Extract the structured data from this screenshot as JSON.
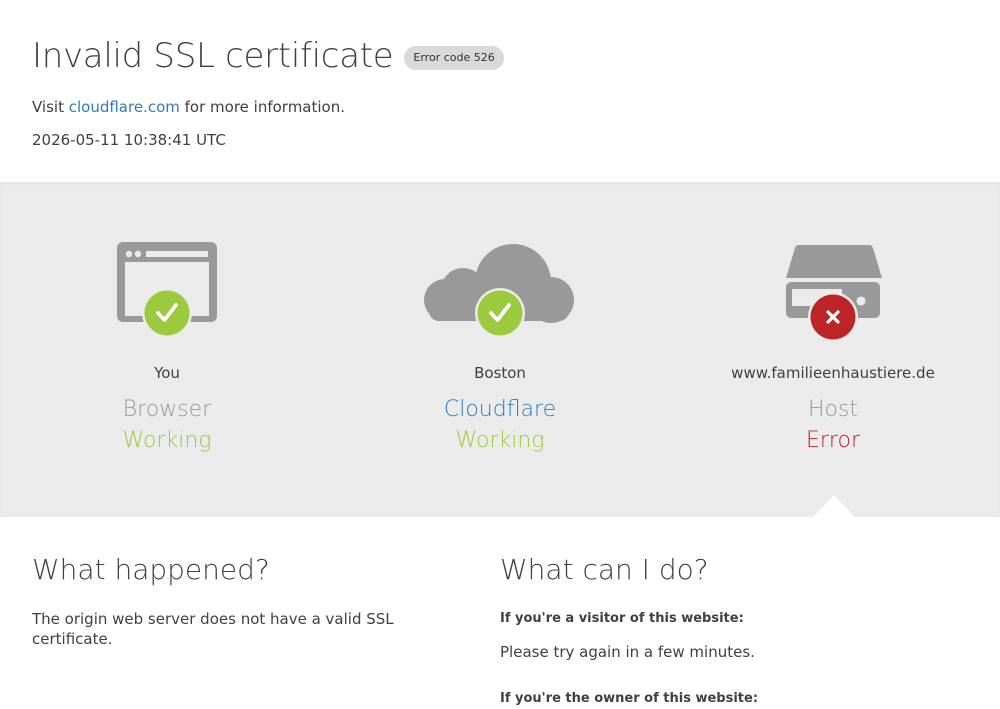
{
  "header": {
    "title": "Invalid SSL certificate",
    "error_badge": "Error code 526",
    "visit_prefix": "Visit ",
    "visit_link": "cloudflare.com",
    "visit_suffix": " for more information.",
    "timestamp": "2026-05-11 10:38:41 UTC"
  },
  "nodes": [
    {
      "location": "You",
      "name": "Browser",
      "status": "Working",
      "icon": "browser-icon",
      "status_icon": "check-icon",
      "status_color": "#9bca3e"
    },
    {
      "location": "Boston",
      "name": "Cloudflare",
      "status": "Working",
      "icon": "cloud-icon",
      "status_icon": "check-icon",
      "status_color": "#9bca3e"
    },
    {
      "location": "www.familieenhaustiere.de",
      "name": "Host",
      "status": "Error",
      "icon": "server-icon",
      "status_icon": "error-x-icon",
      "status_color": "#bd2426"
    }
  ],
  "what_happened": {
    "heading": "What happened?",
    "text": "The origin web server does not have a valid SSL certificate."
  },
  "what_can_i_do": {
    "heading": "What can I do?",
    "visitor_heading": "If you're a visitor of this website:",
    "visitor_text": "Please try again in a few minutes.",
    "owner_heading": "If you're the owner of this website:"
  },
  "colors": {
    "working": "#9bca3e",
    "error": "#bd2426",
    "link": "#2f7bbf",
    "icon_gray": "#999999",
    "band": "#ebebeb"
  }
}
